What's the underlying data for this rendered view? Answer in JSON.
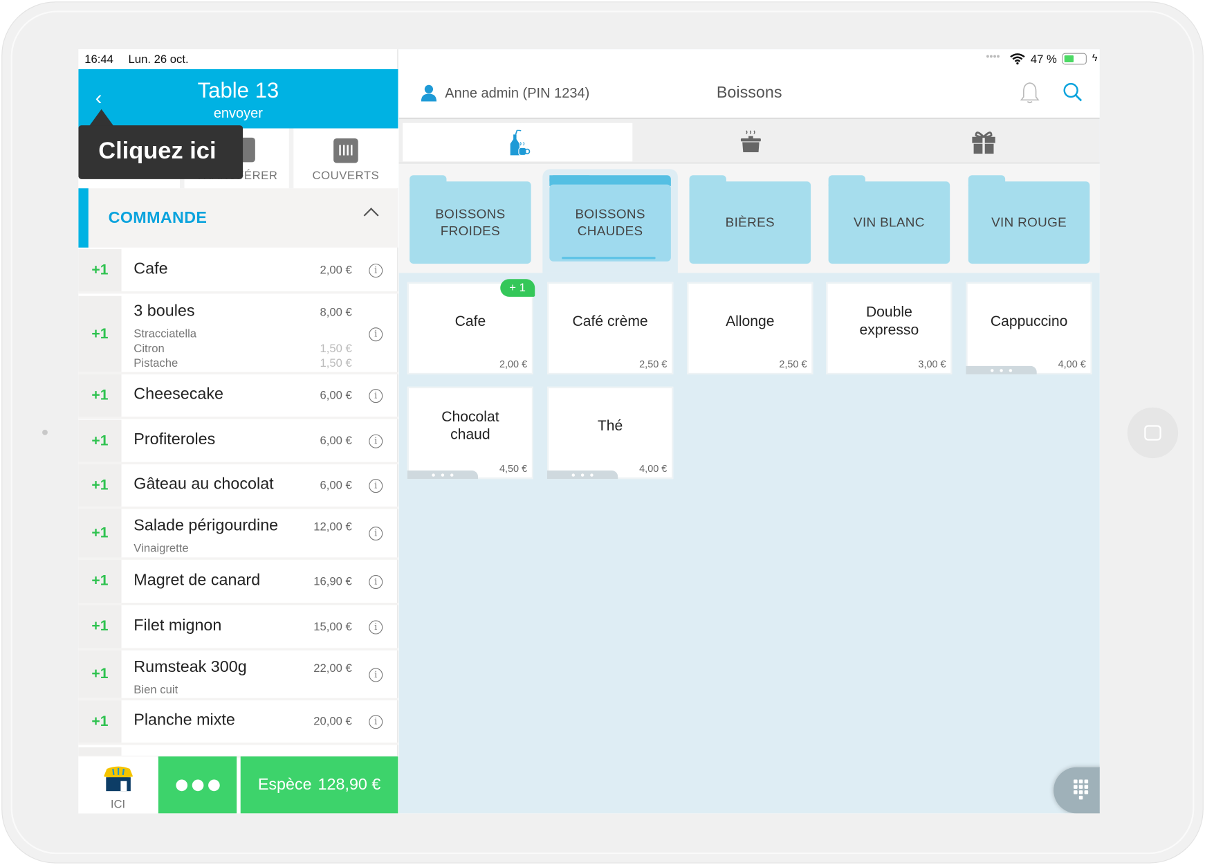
{
  "status_bar": {
    "time": "16:44",
    "date": "Lun. 26 oct.",
    "signal": "••••",
    "battery": "47 %",
    "battery_level": 0.47
  },
  "header": {
    "title": "Table 13",
    "subtitle": "envoyer"
  },
  "actions": [
    {
      "label": ""
    },
    {
      "label": "TRANSFÉRER"
    },
    {
      "label": "COUVERTS"
    }
  ],
  "tooltip": "Cliquez ici",
  "order": {
    "section": "COMMANDE",
    "items": [
      {
        "qty": "+1",
        "name": "Cafe",
        "price": "2,00 €"
      },
      {
        "qty": "+1",
        "name": "3 boules",
        "price": "8,00 €",
        "mods": [
          "Stracciatella",
          "Citron",
          "Pistache"
        ],
        "mod_prices": [
          "",
          "1,50 €",
          "1,50 €"
        ]
      },
      {
        "qty": "+1",
        "name": "Cheesecake",
        "price": "6,00 €"
      },
      {
        "qty": "+1",
        "name": "Profiteroles",
        "price": "6,00 €"
      },
      {
        "qty": "+1",
        "name": "Gâteau au chocolat",
        "price": "6,00 €"
      },
      {
        "qty": "+1",
        "name": "Salade périgourdine",
        "price": "12,00 €",
        "mods": [
          "Vinaigrette"
        ]
      },
      {
        "qty": "+1",
        "name": "Magret de canard",
        "price": "16,90 €"
      },
      {
        "qty": "+1",
        "name": "Filet mignon",
        "price": "15,00 €"
      },
      {
        "qty": "+1",
        "name": "Rumsteak 300g",
        "price": "22,00 €",
        "mods": [
          "Bien cuit"
        ]
      },
      {
        "qty": "+1",
        "name": "Planche mixte",
        "price": "20,00 €"
      }
    ]
  },
  "bottom": {
    "location": "ICI",
    "payment_method": "Espèce",
    "total": "128,90 €"
  },
  "right_header": {
    "user": "Anne admin (PIN 1234)",
    "title": "Boissons"
  },
  "category_tabs": [
    {
      "icon": "drinks-icon",
      "selected": true
    },
    {
      "icon": "cooking-pot-icon"
    },
    {
      "icon": "gift-icon"
    }
  ],
  "folders": [
    {
      "label": "BOISSONS FROIDES"
    },
    {
      "label": "BOISSONS CHAUDES",
      "selected": true
    },
    {
      "label": "BIÈRES"
    },
    {
      "label": "VIN BLANC"
    },
    {
      "label": "VIN ROUGE"
    }
  ],
  "products": [
    {
      "name": "Cafe",
      "price": "2,00 €",
      "badge": "+ 1"
    },
    {
      "name": "Café crème",
      "price": "2,50 €"
    },
    {
      "name": "Allonge",
      "price": "2,50 €"
    },
    {
      "name": "Double expresso",
      "price": "3,00 €"
    },
    {
      "name": "Cappuccino",
      "price": "4,00 €",
      "more": true
    },
    {
      "name": "Chocolat chaud",
      "price": "4,50 €",
      "more": true
    },
    {
      "name": "Thé",
      "price": "4,00 €",
      "more": true
    }
  ],
  "colors": {
    "primary": "#00b2e3",
    "success": "#3dd36b",
    "folder": "#a6dded",
    "background": "#deedf4",
    "tooltip": "#333333"
  }
}
